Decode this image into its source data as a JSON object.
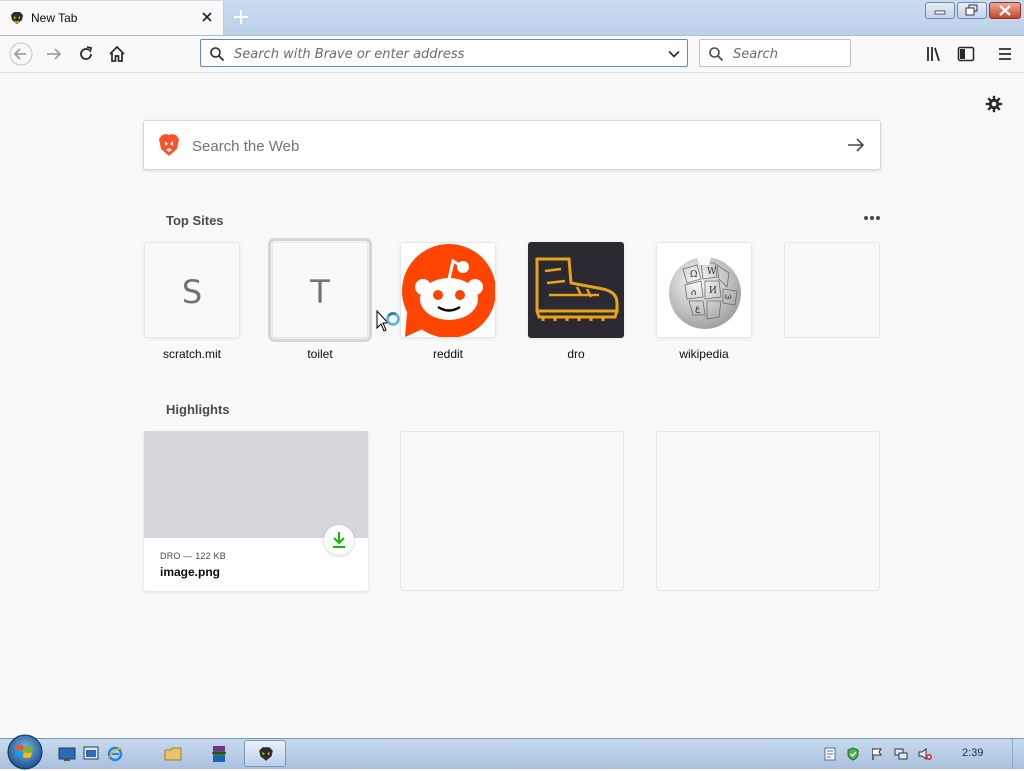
{
  "browser": {
    "tab": {
      "title": "New Tab"
    },
    "urlbar": {
      "placeholder": "Search with Brave or enter address"
    },
    "searchbar": {
      "placeholder": "Search"
    }
  },
  "newtab": {
    "web_search": {
      "placeholder": "Search the Web"
    },
    "top_sites": {
      "title": "Top Sites",
      "sites": [
        {
          "label": "scratch.mit",
          "letter": "S",
          "type": "letter"
        },
        {
          "label": "toilet",
          "letter": "T",
          "type": "letter",
          "hover": true
        },
        {
          "label": "reddit",
          "type": "image",
          "icon": "reddit-logo-icon"
        },
        {
          "label": "dro",
          "type": "image",
          "icon": "boot-icon"
        },
        {
          "label": "wikipedia",
          "type": "image",
          "icon": "wikipedia-globe-icon"
        },
        {
          "label": "",
          "type": "empty"
        }
      ]
    },
    "highlights": {
      "title": "Highlights",
      "items": [
        {
          "meta": "DRO — 122 KB",
          "title": "image.png",
          "badge_icon": "download-icon"
        },
        {
          "meta": "",
          "title": ""
        },
        {
          "meta": "",
          "title": ""
        }
      ]
    }
  },
  "taskbar": {
    "clock": "2:39"
  },
  "colors": {
    "accent": "#5d8acb",
    "reddit": "#ff4500",
    "download_badge": "#12bc00",
    "dro_tile": "#2b2a33",
    "dro_boot": "#e8a317"
  }
}
